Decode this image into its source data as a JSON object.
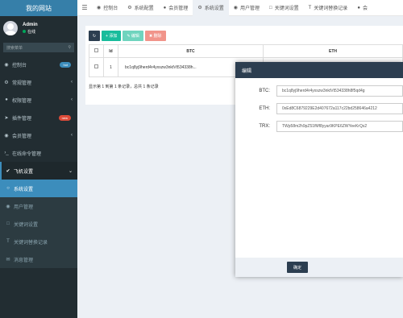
{
  "brand": "我的网站",
  "user": {
    "name": "Admin",
    "status": "在线"
  },
  "search": {
    "placeholder": "搜索菜单"
  },
  "sidebar": {
    "items": [
      {
        "label": "控制台",
        "icon": "dashboard-icon",
        "badge": "hot"
      },
      {
        "label": "常规管理",
        "icon": "cogs-icon"
      },
      {
        "label": "权限管理",
        "icon": "group-icon"
      },
      {
        "label": "插件管理",
        "icon": "rocket-icon",
        "badge": "new"
      },
      {
        "label": "会员管理",
        "icon": "user-circle-icon"
      },
      {
        "label": "在线命令管理",
        "icon": "terminal-icon"
      },
      {
        "label": "飞机设置",
        "icon": "circle-check-icon"
      }
    ],
    "sub_items": [
      {
        "label": "系统设置",
        "icon": "circle-icon",
        "active": true
      },
      {
        "label": "用户管理",
        "icon": "user-icon"
      },
      {
        "label": "关键词设置",
        "icon": "doc-icon"
      },
      {
        "label": "关键词替换记录",
        "icon": "text-icon"
      },
      {
        "label": "消息管理",
        "icon": "message-icon"
      }
    ]
  },
  "tabs": [
    {
      "label": "控制台",
      "icon": "dashboard-icon"
    },
    {
      "label": "系统配置",
      "icon": "cogs-icon"
    },
    {
      "label": "会员管理",
      "icon": "user-icon"
    },
    {
      "label": "系统设置",
      "icon": "gear-icon",
      "active": true
    },
    {
      "label": "用户管理",
      "icon": "user-circle-icon"
    },
    {
      "label": "关键词设置",
      "icon": "doc-icon"
    },
    {
      "label": "关键词替换记录",
      "icon": "text-icon"
    },
    {
      "label": "会",
      "icon": "user-icon"
    }
  ],
  "toolbar": {
    "add_label": "添加",
    "edit_label": "编辑",
    "delete_label": "删除"
  },
  "table": {
    "columns": [
      "",
      "Id",
      "BTC",
      "ETH"
    ],
    "rows": [
      {
        "id": "1",
        "btc": "bc1q8yj9herd4r4yxszw3nktVt534338h..."
      }
    ]
  },
  "pager_info": "显示第 1 到第 1 条记录，总共 1 条记录",
  "modal": {
    "title": "编辑",
    "fields": [
      {
        "label": "BTC:",
        "value": "bc1q8yj9herd4r4yxszw3nktVt534338h8f5qd4g"
      },
      {
        "label": "ETH:",
        "value": "0xEd8C6879229E2d407672a117c22bd258646a4212"
      },
      {
        "label": "TRX:",
        "value": "TWp58m2h9pZ51fMf8yyar9KPE6ZWYeeKrQs2"
      }
    ],
    "ok_label": "确定"
  }
}
